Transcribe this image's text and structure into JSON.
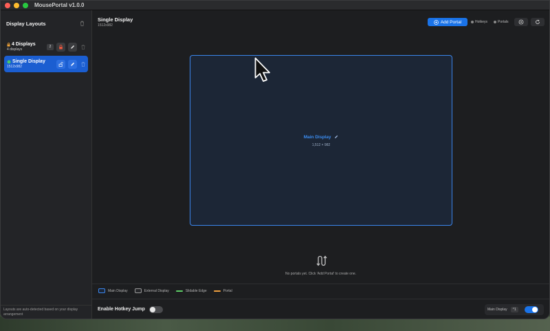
{
  "window": {
    "title": "MousePortal v1.0.0"
  },
  "sidebar": {
    "title": "Display Layouts",
    "items": [
      {
        "name": "4 Displays",
        "sub": "4 displays",
        "badge": "2"
      },
      {
        "name": "Single Display",
        "sub": "1512x982"
      }
    ],
    "footer": "Layouts are auto-detected based on your display arrangement"
  },
  "header": {
    "title": "Single Display",
    "subtitle": "1512x982",
    "add_portal_label": "Add Portal",
    "hotkeys_label": "Hotkeys",
    "portals_label": "Portals"
  },
  "canvas": {
    "display_name": "Main Display",
    "display_dims": "1,512 × 982",
    "empty_message": "No portals yet. Click 'Add Portal' to create one."
  },
  "legend": {
    "items": [
      {
        "label": "Main Display",
        "color": "#3b86ee"
      },
      {
        "label": "External Display",
        "color": "#9a9a9a"
      },
      {
        "label": "Slidable Edge",
        "color": "#5fd068"
      },
      {
        "label": "Portal",
        "color": "#f0a040"
      }
    ]
  },
  "footer": {
    "hotkey_label": "Enable Hotkey Jump",
    "hotkey_enabled": false,
    "target_display": "Main Display",
    "target_shortcut": "^1",
    "target_enabled": true
  },
  "colors": {
    "accent": "#1a73e8",
    "selected": "#1b5ed1",
    "display_border": "#3b86ee"
  }
}
